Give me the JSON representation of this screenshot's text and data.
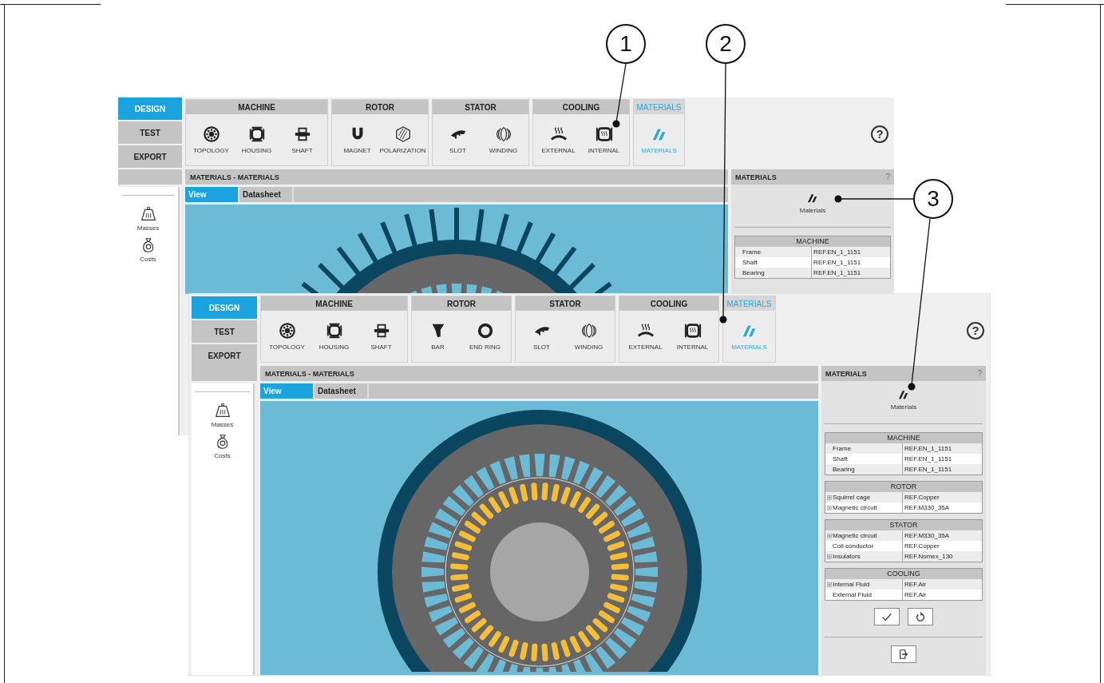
{
  "callouts": [
    {
      "number": "1"
    },
    {
      "number": "2"
    },
    {
      "number": "3"
    }
  ],
  "windows": [
    {
      "nav": [
        {
          "label": "DESIGN",
          "selected": true
        },
        {
          "label": "TEST",
          "selected": false
        },
        {
          "label": "EXPORT",
          "selected": false
        }
      ],
      "ribbon": [
        {
          "title": "MACHINE",
          "selected": false,
          "tools": [
            {
              "label": "TOPOLOGY",
              "kind": "topology",
              "selected": false
            },
            {
              "label": "HOUSING",
              "kind": "housing",
              "selected": false
            },
            {
              "label": "SHAFT",
              "kind": "shaft",
              "selected": false
            }
          ]
        },
        {
          "title": "ROTOR",
          "selected": false,
          "tools": [
            {
              "label": "MAGNET",
              "kind": "magnet",
              "selected": false
            },
            {
              "label": "POLARIZATION",
              "kind": "polarization",
              "selected": false
            }
          ]
        },
        {
          "title": "STATOR",
          "selected": false,
          "tools": [
            {
              "label": "SLOT",
              "kind": "slot",
              "selected": false
            },
            {
              "label": "WINDING",
              "kind": "winding",
              "selected": false
            }
          ]
        },
        {
          "title": "COOLING",
          "selected": false,
          "tools": [
            {
              "label": "EXTERNAL",
              "kind": "external",
              "selected": false
            },
            {
              "label": "INTERNAL",
              "kind": "internal",
              "selected": false
            }
          ]
        },
        {
          "title": "MATERIALS",
          "selected": true,
          "tools": [
            {
              "label": "MATERIALS",
              "kind": "materials",
              "selected": true
            }
          ]
        }
      ],
      "help": "?",
      "page_title": "MATERIALS - MATERIALS",
      "view_tabs": [
        {
          "label": "View",
          "selected": true
        },
        {
          "label": "Datasheet",
          "selected": false
        }
      ],
      "sidebar": [
        {
          "label": "Masses",
          "kind": "masses"
        },
        {
          "label": "Costs",
          "kind": "costs"
        }
      ],
      "panel": {
        "title": "MATERIALS",
        "help": "?",
        "label": "Materials",
        "sections": [
          {
            "title": "MACHINE",
            "rows": [
              {
                "name": "Frame",
                "value": "REF.EN_1_1151",
                "expandable": false
              },
              {
                "name": "Shaft",
                "value": "REF.EN_1_1151",
                "expandable": false
              },
              {
                "name": "Bearing",
                "value": "REF.EN_1_1151",
                "expandable": false
              }
            ]
          }
        ]
      }
    },
    {
      "nav": [
        {
          "label": "DESIGN",
          "selected": true
        },
        {
          "label": "TEST",
          "selected": false
        },
        {
          "label": "EXPORT",
          "selected": false
        }
      ],
      "ribbon": [
        {
          "title": "MACHINE",
          "selected": false,
          "tools": [
            {
              "label": "TOPOLOGY",
              "kind": "topology",
              "selected": false
            },
            {
              "label": "HOUSING",
              "kind": "housing",
              "selected": false
            },
            {
              "label": "SHAFT",
              "kind": "shaft",
              "selected": false
            }
          ]
        },
        {
          "title": "ROTOR",
          "selected": false,
          "tools": [
            {
              "label": "BAR",
              "kind": "bar",
              "selected": false
            },
            {
              "label": "END RING",
              "kind": "endring",
              "selected": false
            }
          ]
        },
        {
          "title": "STATOR",
          "selected": false,
          "tools": [
            {
              "label": "SLOT",
              "kind": "slot",
              "selected": false
            },
            {
              "label": "WINDING",
              "kind": "winding",
              "selected": false
            }
          ]
        },
        {
          "title": "COOLING",
          "selected": false,
          "tools": [
            {
              "label": "EXTERNAL",
              "kind": "external",
              "selected": false
            },
            {
              "label": "INTERNAL",
              "kind": "internal",
              "selected": false
            }
          ]
        },
        {
          "title": "MATERIALS",
          "selected": true,
          "tools": [
            {
              "label": "MATERIALS",
              "kind": "materials",
              "selected": true
            }
          ]
        }
      ],
      "help": "?",
      "page_title": "MATERIALS - MATERIALS",
      "view_tabs": [
        {
          "label": "View",
          "selected": true
        },
        {
          "label": "Datasheet",
          "selected": false
        }
      ],
      "sidebar": [
        {
          "label": "Masses",
          "kind": "masses"
        },
        {
          "label": "Costs",
          "kind": "costs"
        }
      ],
      "panel": {
        "title": "MATERIALS",
        "help": "?",
        "label": "Materials",
        "sections": [
          {
            "title": "MACHINE",
            "rows": [
              {
                "name": "Frame",
                "value": "REF.EN_1_1151",
                "expandable": false
              },
              {
                "name": "Shaft",
                "value": "REF.EN_1_1151",
                "expandable": false
              },
              {
                "name": "Bearing",
                "value": "REF.EN_1_1151",
                "expandable": false
              }
            ]
          },
          {
            "title": "ROTOR",
            "rows": [
              {
                "name": "Squirrel cage",
                "value": "REF.Copper",
                "expandable": true
              },
              {
                "name": "Magnetic circuit",
                "value": "REF.M330_35A",
                "expandable": true
              }
            ]
          },
          {
            "title": "STATOR",
            "rows": [
              {
                "name": "Magnetic circuit",
                "value": "REF.M330_35A",
                "expandable": true
              },
              {
                "name": "Coil conductor",
                "value": "REF.Copper",
                "expandable": false
              },
              {
                "name": "Insulators",
                "value": "REF.Nomex_130",
                "expandable": true
              }
            ]
          },
          {
            "title": "COOLING",
            "rows": [
              {
                "name": "Internal Fluid",
                "value": "REF.Air",
                "expandable": true
              },
              {
                "name": "External Fluid",
                "value": "REF.Air",
                "expandable": false
              }
            ]
          }
        ],
        "actions": [
          {
            "kind": "apply"
          },
          {
            "kind": "reset"
          }
        ],
        "footer_actions": [
          {
            "kind": "exit"
          }
        ]
      }
    }
  ]
}
